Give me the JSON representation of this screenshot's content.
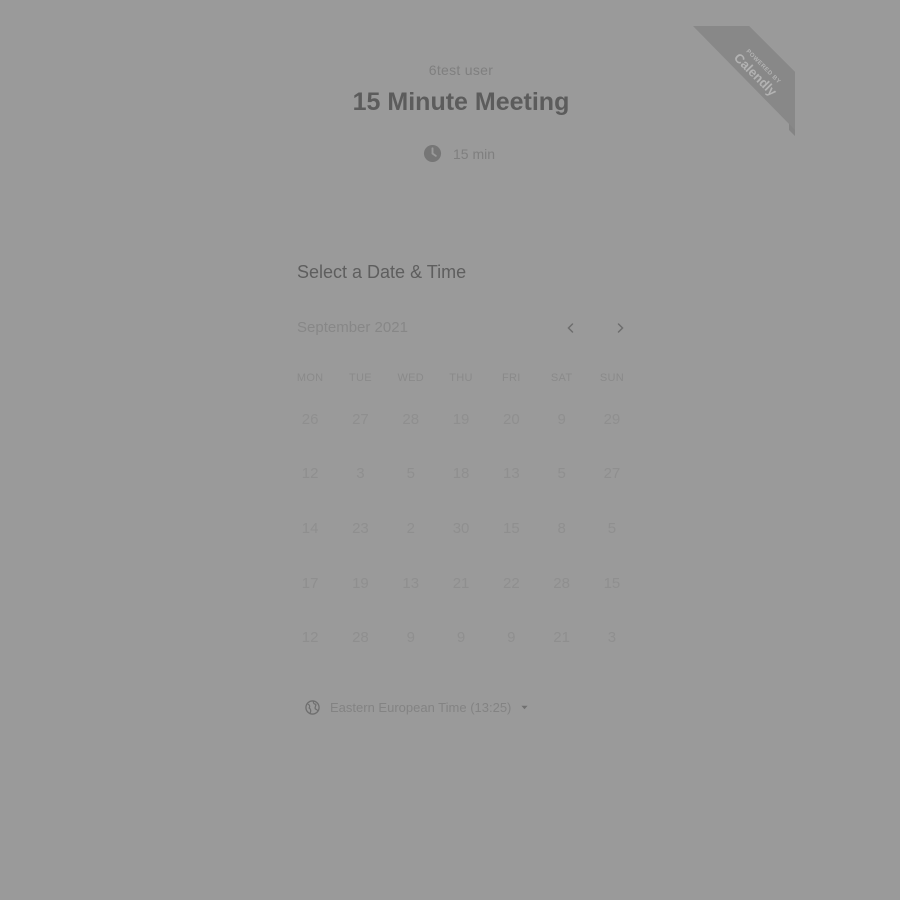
{
  "ribbon": {
    "small": "POWERED BY",
    "brand": "Calendly"
  },
  "host": "6test user",
  "title": "15 Minute Meeting",
  "duration": "15 min",
  "section_title": "Select a Date & Time",
  "calendar": {
    "month": "September 2021",
    "weekdays": [
      "MON",
      "TUE",
      "WED",
      "THU",
      "FRI",
      "SAT",
      "SUN"
    ],
    "weeks": [
      [
        "26",
        "27",
        "28",
        "19",
        "20",
        "9",
        "29"
      ],
      [
        "12",
        "3",
        "5",
        "18",
        "13",
        "5",
        "27"
      ],
      [
        "14",
        "23",
        "2",
        "30",
        "15",
        "8",
        "5"
      ],
      [
        "17",
        "19",
        "13",
        "21",
        "22",
        "28",
        "15"
      ],
      [
        "12",
        "28",
        "9",
        "9",
        "9",
        "21",
        "3"
      ]
    ]
  },
  "timezone": {
    "label": "Eastern European Time (13:25)"
  },
  "colors": {
    "overlay": "#9a9a9a",
    "ribbon": "#848484"
  }
}
